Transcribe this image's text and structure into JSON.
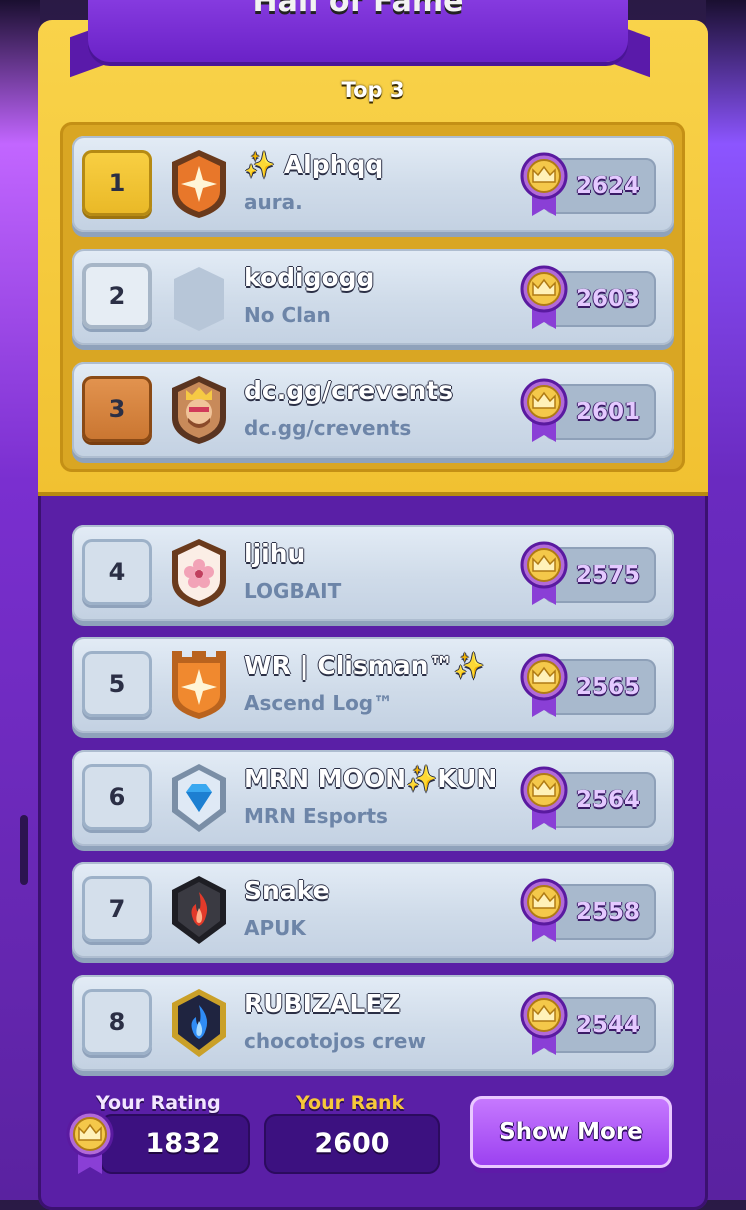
{
  "header": {
    "title": "Hall of Fame",
    "subtitle": "Top 3"
  },
  "leaderboard": {
    "rows": [
      {
        "rank": "1",
        "name": "✨ Alphqq",
        "clan": "aura.",
        "rating": "2624",
        "badge_icon": "orange-star-clan-badge-icon"
      },
      {
        "rank": "2",
        "name": "kodigogg",
        "clan": "No Clan",
        "rating": "2603",
        "badge_icon": "empty-clan-badge-icon"
      },
      {
        "rank": "3",
        "name": "dc.gg/crevents",
        "clan": "dc.gg/crevents",
        "rating": "2601",
        "badge_icon": "king-clan-badge-icon"
      },
      {
        "rank": "4",
        "name": "ljihu",
        "clan": "LOGBAIT",
        "rating": "2575",
        "badge_icon": "flower-clan-badge-icon"
      },
      {
        "rank": "5",
        "name": "WR | Clisman™✨",
        "clan": "Ascend Log™",
        "rating": "2565",
        "badge_icon": "orange-star-tower-clan-badge-icon"
      },
      {
        "rank": "6",
        "name": "MRN MOON✨KUN",
        "clan": "MRN Esports",
        "rating": "2564",
        "badge_icon": "diamond-clan-badge-icon"
      },
      {
        "rank": "7",
        "name": "Snake",
        "clan": "APUK",
        "rating": "2558",
        "badge_icon": "red-flame-clan-badge-icon"
      },
      {
        "rank": "8",
        "name": "RUBIZALEZ",
        "clan": "chocotojos crew",
        "rating": "2544",
        "badge_icon": "blue-flame-clan-badge-icon"
      }
    ]
  },
  "footer": {
    "your_rating_label": "Your Rating",
    "your_rating": "1832",
    "your_rank_label": "Your Rank",
    "your_rank": "2600",
    "show_more_label": "Show More"
  },
  "colors": {
    "gold": "#f1c131",
    "purple": "#5a1fa6",
    "card": "#d4dfeb",
    "rating_text": "#e4c9ff"
  }
}
